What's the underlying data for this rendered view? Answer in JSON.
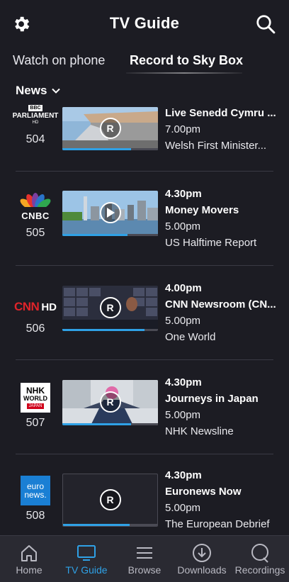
{
  "header": {
    "title": "TV Guide",
    "settings_icon": "gear-icon",
    "search_icon": "search-icon"
  },
  "tabs": [
    {
      "label": "Watch on phone",
      "active": false
    },
    {
      "label": "Record to Sky Box",
      "active": true
    }
  ],
  "category": {
    "label": "News",
    "icon": "chevron-down-icon"
  },
  "colors": {
    "background": "#1c1c23",
    "accent": "#2fa1e6",
    "nav_background": "#2a2a32"
  },
  "channels": [
    {
      "number": "504",
      "logo_text": [
        "BBC",
        "PARLIAMENT",
        "HD"
      ],
      "overlay": "R",
      "progress": 0.72,
      "lines": [
        {
          "text": "Live Senedd Cymru ...",
          "bold": true
        },
        {
          "text": "7.00pm",
          "bold": false
        },
        {
          "text": "Welsh First Minister...",
          "bold": false
        }
      ]
    },
    {
      "number": "505",
      "logo_text": [
        "CNBC"
      ],
      "overlay": "play",
      "progress": 0.68,
      "lines": [
        {
          "text": "4.30pm",
          "bold": true
        },
        {
          "text": "Money Movers",
          "bold": true
        },
        {
          "text": "5.00pm",
          "bold": false
        },
        {
          "text": "US Halftime Report",
          "bold": false
        }
      ]
    },
    {
      "number": "506",
      "logo_text": [
        "CNN",
        "HD"
      ],
      "overlay": "R",
      "progress": 0.86,
      "lines": [
        {
          "text": "4.00pm",
          "bold": true
        },
        {
          "text": "CNN Newsroom (CN...",
          "bold": true
        },
        {
          "text": "5.00pm",
          "bold": false
        },
        {
          "text": "One World",
          "bold": false
        }
      ]
    },
    {
      "number": "507",
      "logo_text": [
        "NHK",
        "WORLD",
        "JAPAN"
      ],
      "overlay": "R",
      "progress": 0.72,
      "lines": [
        {
          "text": "4.30pm",
          "bold": true
        },
        {
          "text": "Journeys in Japan",
          "bold": true
        },
        {
          "text": "5.00pm",
          "bold": false
        },
        {
          "text": "NHK Newsline",
          "bold": false
        }
      ]
    },
    {
      "number": "508",
      "logo_text": [
        "euro",
        "news."
      ],
      "overlay": "R",
      "progress": 0.71,
      "lines": [
        {
          "text": "4.30pm",
          "bold": true
        },
        {
          "text": "Euronews Now",
          "bold": true
        },
        {
          "text": "5.00pm",
          "bold": false
        },
        {
          "text": "The European Debrief",
          "bold": false
        }
      ]
    }
  ],
  "bottom_nav": [
    {
      "label": "Home",
      "icon": "home-icon",
      "active": false
    },
    {
      "label": "TV Guide",
      "icon": "tv-icon",
      "active": true
    },
    {
      "label": "Browse",
      "icon": "menu-icon",
      "active": false
    },
    {
      "label": "Downloads",
      "icon": "download-icon",
      "active": false
    },
    {
      "label": "Recordings",
      "icon": "recordings-icon",
      "active": false
    }
  ]
}
